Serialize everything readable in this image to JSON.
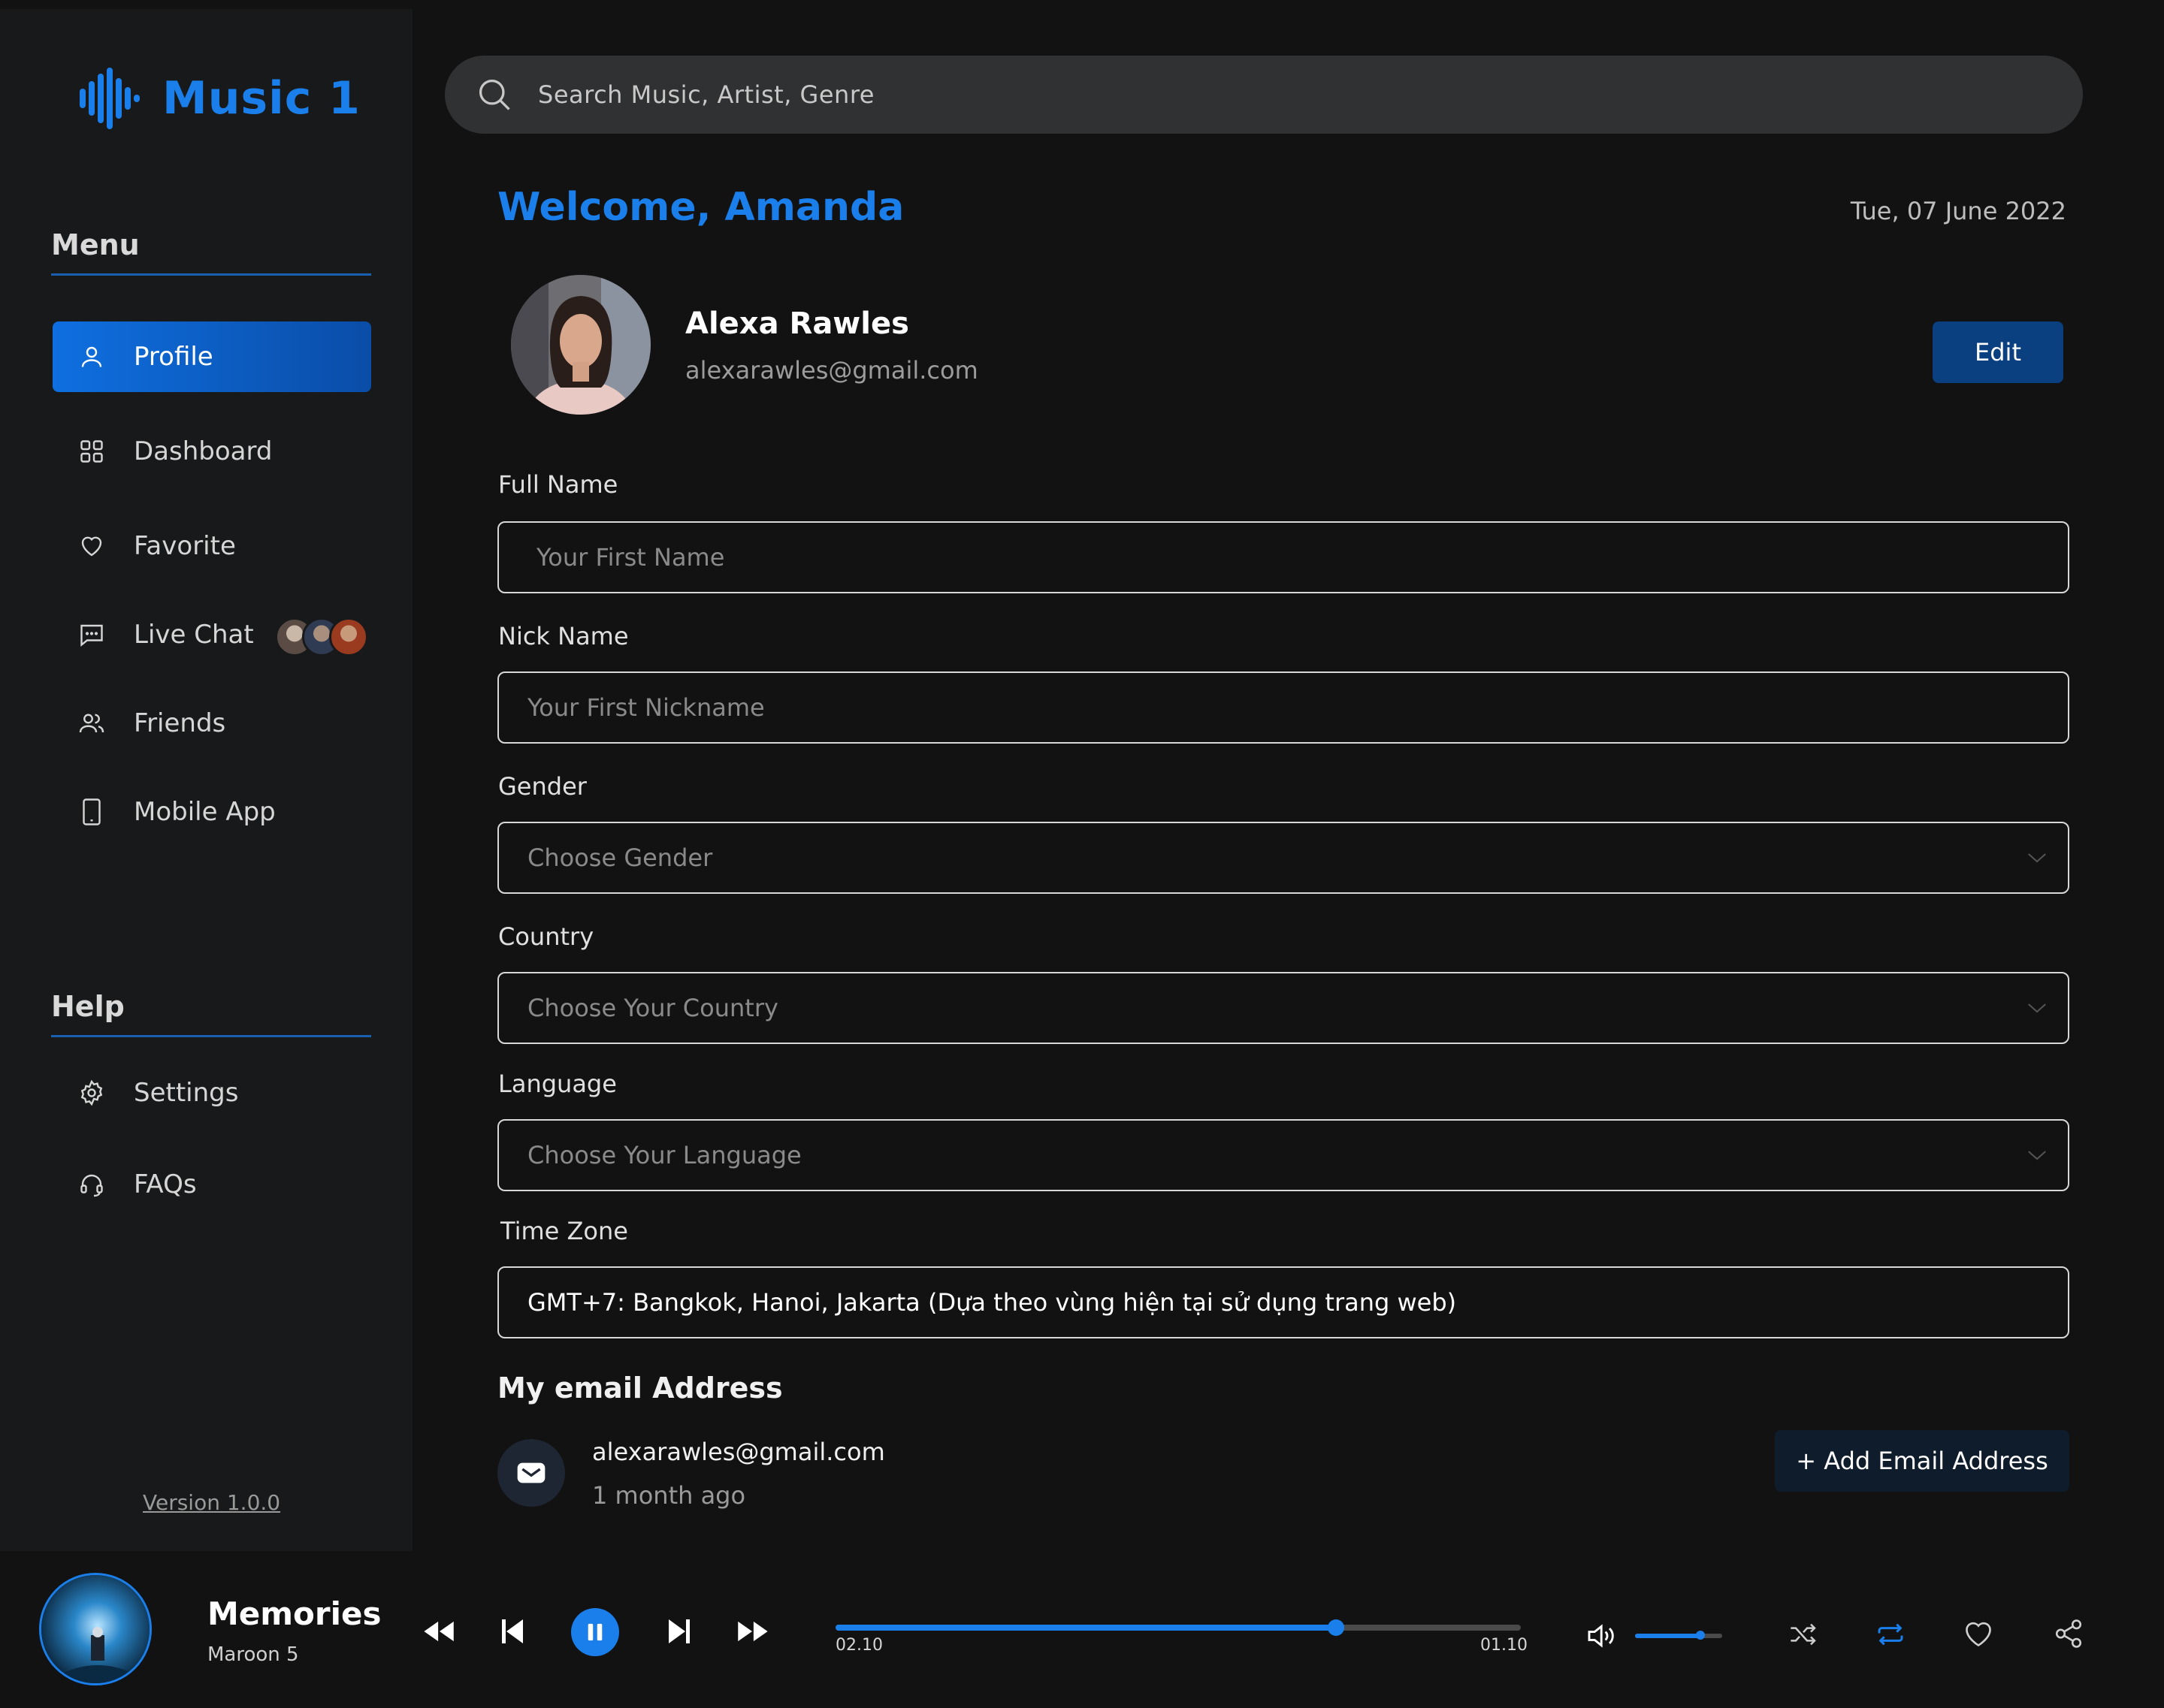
{
  "app": {
    "name": "Music 1",
    "version": "Version 1.0.0"
  },
  "search": {
    "placeholder": "Search Music, Artist, Genre"
  },
  "sidebar": {
    "menu_heading": "Menu",
    "help_heading": "Help",
    "menu_items": [
      {
        "label": "Profile",
        "icon": "user-icon",
        "active": true
      },
      {
        "label": "Dashboard",
        "icon": "grid-icon"
      },
      {
        "label": "Favorite",
        "icon": "heart-icon"
      },
      {
        "label": "Live Chat",
        "icon": "chat-icon"
      },
      {
        "label": "Friends",
        "icon": "users-icon"
      },
      {
        "label": "Mobile App",
        "icon": "mobile-icon"
      }
    ],
    "help_items": [
      {
        "label": "Settings",
        "icon": "gear-icon"
      },
      {
        "label": "FAQs",
        "icon": "headset-icon"
      }
    ]
  },
  "header": {
    "welcome": "Welcome, Amanda",
    "date": "Tue, 07 June 2022"
  },
  "profile": {
    "name": "Alexa Rawles",
    "email": "alexarawles@gmail.com",
    "edit_label": "Edit"
  },
  "form": {
    "full_name": {
      "label": "Full Name",
      "placeholder": "Your First Name"
    },
    "nick_name": {
      "label": "Nick Name",
      "placeholder": "Your First Nickname"
    },
    "gender": {
      "label": "Gender",
      "placeholder": "Choose Gender"
    },
    "country": {
      "label": "Country",
      "placeholder": "Choose Your Country"
    },
    "language": {
      "label": "Language",
      "placeholder": "Choose Your Language"
    },
    "time_zone": {
      "label": "Time Zone",
      "value": "GMT+7: Bangkok, Hanoi, Jakarta (Dựa theo vùng hiện tại sử dụng trang web)"
    }
  },
  "emails": {
    "heading": "My email Address",
    "items": [
      {
        "address": "alexarawles@gmail.com",
        "added": "1 month ago"
      }
    ],
    "add_label": "+ Add Email Address"
  },
  "player": {
    "title": "Memories",
    "artist": "Maroon 5",
    "elapsed": "02.10",
    "remaining": "01.10",
    "progress": 0.73,
    "volume": 0.75,
    "state": "playing"
  },
  "colors": {
    "accent": "#1a7fea",
    "background": "#121213",
    "sidebar": "#18191a",
    "edit_button": "#0a3f80"
  }
}
